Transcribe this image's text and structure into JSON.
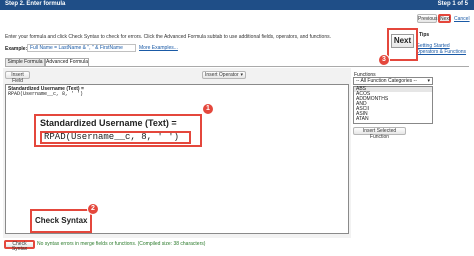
{
  "header": {
    "title": "Step 2. Enter formula",
    "step": "Step 1 of 5"
  },
  "nav": {
    "previous": "Previous",
    "next": "Next",
    "cancel": "Cancel"
  },
  "instructions": "Enter your formula and click Check Syntax to check for errors. Click the Advanced Formula subtab to use additional fields, operators, and functions.",
  "example": {
    "label": "Example:",
    "value": "Full Name = LastName & \", \" & FirstName",
    "more_link": "More Examples..."
  },
  "tabs": {
    "simple": "Simple Formula",
    "advanced": "Advanced Formula"
  },
  "toolbar": {
    "insert_field": "Insert Field",
    "insert_operator": "Insert Operator"
  },
  "editor": {
    "label": "Standardized Username (Text) =",
    "formula": "RPAD(Username__c, 8, ' ')"
  },
  "callouts": {
    "formula_label": "Standardized Username (Text) =",
    "formula_text": "RPAD(Username__c, 8, ' ')",
    "check_syntax_label": "Check Syntax",
    "next_label": "Next",
    "badge_1": "1",
    "badge_2": "2",
    "badge_3": "3"
  },
  "functions": {
    "label": "Functions",
    "category": "-- All Function Categories --",
    "items": [
      "ABS",
      "ACOS",
      "ADDMONTHS",
      "AND",
      "ASCII",
      "ASIN",
      "ATAN"
    ],
    "insert_button": "Insert Selected Function"
  },
  "tips": {
    "heading": "Tips",
    "link_1": "Getting Started",
    "link_2": "Operators & Functions"
  },
  "bottom": {
    "check_syntax": "Check Syntax",
    "status": "No syntax errors in merge fields or functions. (Compiled size: 38 characters)"
  },
  "colors": {
    "header": "#1f4e87",
    "annotation": "#e4473c",
    "link": "#1a5aa6"
  }
}
